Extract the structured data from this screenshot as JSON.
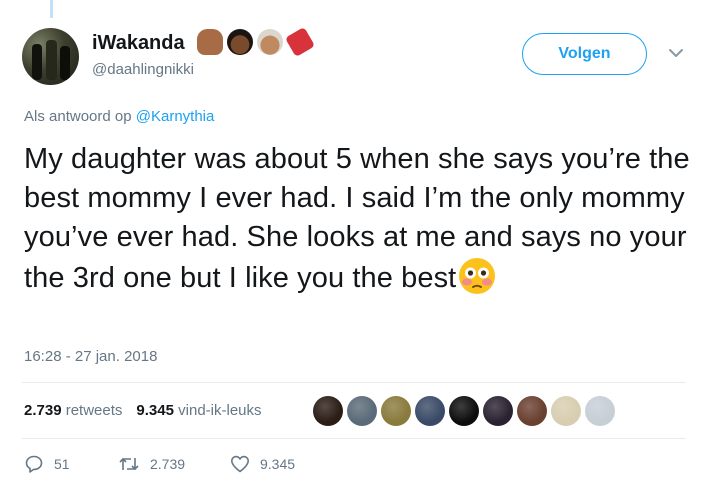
{
  "tweet": {
    "display_name": "iWakanda",
    "name_emojis": [
      "raised-fist-icon",
      "woman-emoji-icon",
      "man-turban-emoji-icon",
      "ticket-emoji-icon"
    ],
    "handle": "@daahlingnikki",
    "follow_label": "Volgen",
    "reply_prefix": "Als antwoord op",
    "reply_mention": "@Karnythia",
    "text": "My daughter was about 5 when she says you’re the best mommy I ever had. I said I’m the only mommy you’ve ever had. She looks at me and says no your the 3rd one but I like you the best",
    "text_emoji": "flushed-face-icon",
    "timestamp": "16:28 - 27 jan. 2018"
  },
  "stats": {
    "retweets_count": "2.739",
    "retweets_label": "retweets",
    "likes_count": "9.345",
    "likes_label": "vind-ik-leuks"
  },
  "likers": [
    {
      "color": "#2b1d16"
    },
    {
      "color": "#5a6a78"
    },
    {
      "color": "#8a7a3c"
    },
    {
      "color": "#3a4a66"
    },
    {
      "color": "#0d0d0d"
    },
    {
      "color": "#2a2230"
    },
    {
      "color": "#6a4030"
    },
    {
      "color": "#d8cdb0"
    },
    {
      "color": "#c6ced6"
    }
  ],
  "actions": {
    "replies": "51",
    "retweets": "2.739",
    "likes": "9.345"
  },
  "colors": {
    "accent": "#1da1f2",
    "secondary_text": "#657786",
    "divider": "#e6ecf0"
  }
}
